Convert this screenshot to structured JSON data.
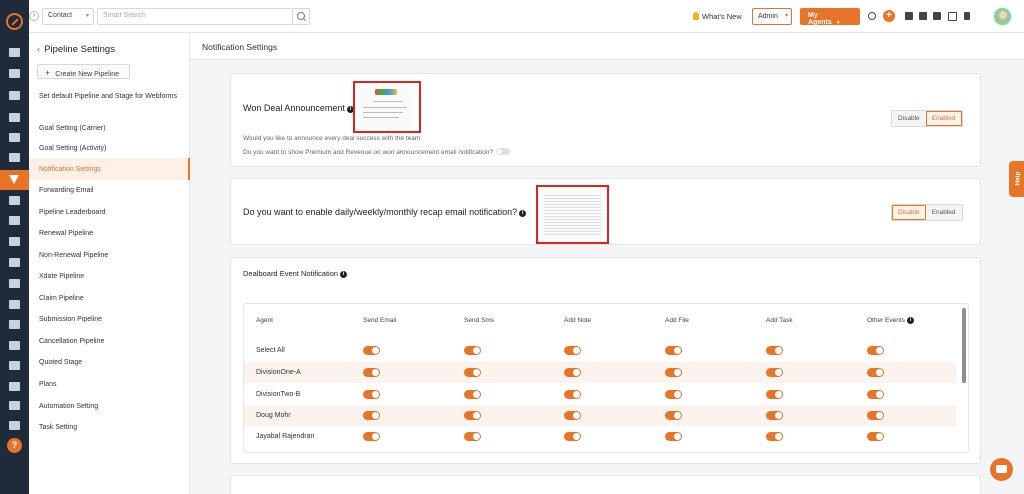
{
  "topbar": {
    "contact_select": "Contact",
    "search_placeholder": "Smart Search",
    "whats_new": "What's New",
    "admin_select": "Admin",
    "my_agents": "My Agents"
  },
  "sidebar": {
    "title": "Pipeline Settings",
    "create_button": "Create New Pipeline",
    "items": [
      "Set default Pipeline and Stage for Webforms",
      "Goal Setting (Carrier)",
      "Goal Setting (Activity)",
      "Notification Settings",
      "Forwarding Email",
      "Pipeline Leaderboard",
      "Renewal Pipeline",
      "Non-Renewal Pipeline",
      "Xdate Pipeline",
      "Claim Pipeline",
      "Submission Pipeline",
      "Cancellation Pipeline",
      "Quoted Stage",
      "Plans",
      "Automation Setting",
      "Task Setting"
    ],
    "active_index": 3
  },
  "main": {
    "title": "Notification Settings",
    "won_deal": {
      "title": "Won Deal Announcement",
      "q1": "Would you like to announce every deal success with the team",
      "q2": "Do you want to show Premium and Revenue on won announcement email notification?",
      "disable_label": "Disable",
      "enable_label": "Enabled",
      "state": "Enabled"
    },
    "recap": {
      "title": "Do you want to enable daily/weekly/monthly recap email notification?",
      "disable_label": "Disable",
      "enable_label": "Enabled",
      "state": "Disable"
    },
    "dealboard": {
      "title": "Dealboard Event Notification",
      "columns": [
        "Agent",
        "Send Email",
        "Send Sms",
        "Add Note",
        "Add File",
        "Add Task",
        "Other Events"
      ],
      "rows": [
        {
          "agent": "Select All",
          "values": [
            true,
            true,
            true,
            true,
            true,
            true
          ]
        },
        {
          "agent": "DivisionOne-A",
          "values": [
            true,
            true,
            true,
            true,
            true,
            true
          ]
        },
        {
          "agent": "DivisionTwo-B",
          "values": [
            true,
            true,
            true,
            true,
            true,
            true
          ]
        },
        {
          "agent": "Doug Mohr",
          "values": [
            true,
            true,
            true,
            true,
            true,
            true
          ]
        },
        {
          "agent": "Jayabal Rajendran",
          "values": [
            true,
            true,
            true,
            true,
            true,
            true
          ]
        }
      ]
    }
  },
  "help_tab": "Help",
  "colors": {
    "accent": "#e8742a",
    "rail": "#1d2b3a",
    "highlight_box": "#e0231f"
  },
  "icons": {
    "thumbnail_1_word": "Congrats"
  }
}
